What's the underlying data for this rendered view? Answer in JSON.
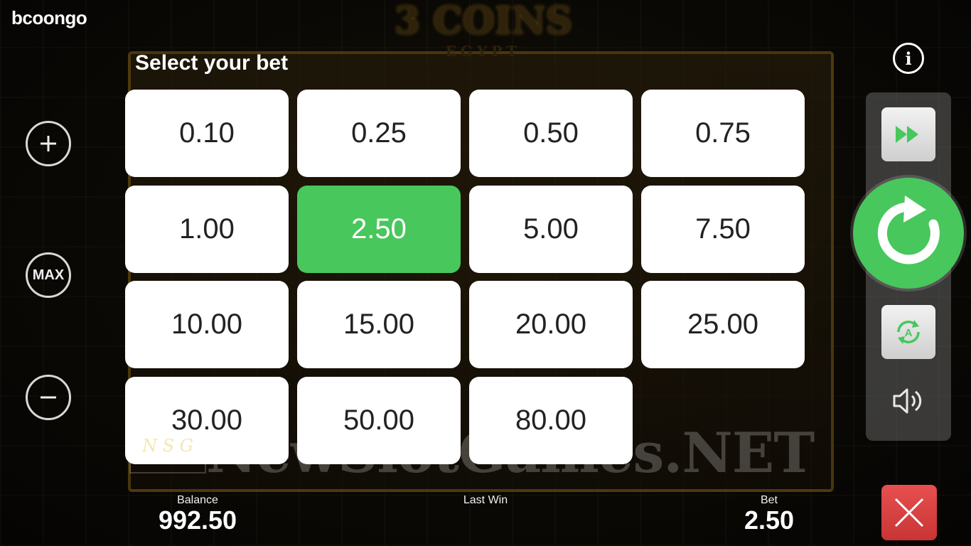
{
  "brand": {
    "logo_text": "bcoongo"
  },
  "game": {
    "title_big": "3 COINS",
    "title_small": "EGYPT"
  },
  "bet_panel": {
    "title": "Select your bet",
    "options": [
      "0.10",
      "0.25",
      "0.50",
      "0.75",
      "1.00",
      "2.50",
      "5.00",
      "7.50",
      "10.00",
      "15.00",
      "20.00",
      "25.00",
      "30.00",
      "50.00",
      "80.00"
    ],
    "selected": "2.50"
  },
  "left_controls": {
    "max_label": "MAX"
  },
  "right_controls": {
    "info_label": "i"
  },
  "footer": {
    "balance_label": "Balance",
    "balance_value": "992.50",
    "lastwin_label": "Last Win",
    "lastwin_value": "",
    "bet_label": "Bet",
    "bet_value": "2.50"
  },
  "watermark": {
    "text": "NewSlotGames.NET",
    "logo_text": "N S G"
  },
  "colors": {
    "accent_green": "#48c75c",
    "close_red": "#d94141",
    "tile_white": "#ffffff"
  },
  "icons": [
    "plus-icon",
    "minus-icon",
    "info-icon",
    "fast-forward-icon",
    "spin-icon",
    "autoplay-icon",
    "sound-icon",
    "close-icon"
  ]
}
